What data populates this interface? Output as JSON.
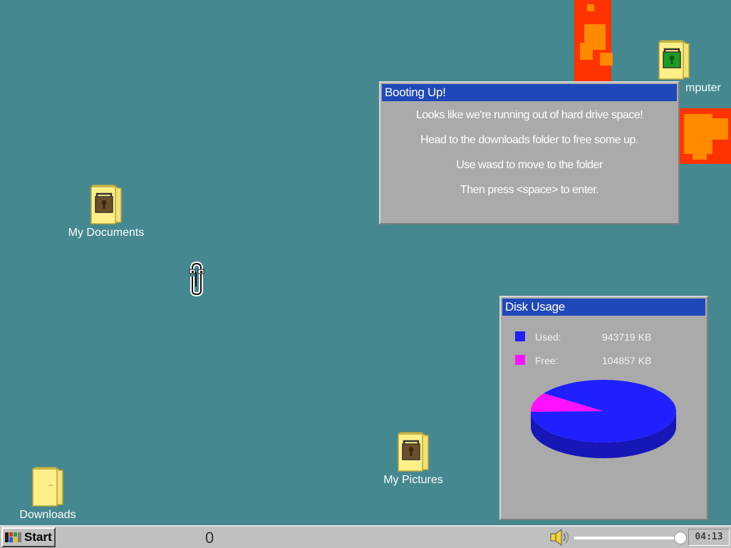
{
  "desktop": {
    "background": "#458890",
    "icons": [
      {
        "label": "My Documents",
        "icon": "locked-folder-icon",
        "lock_color": "#6b4f2a"
      },
      {
        "label": "mputer",
        "icon": "locked-folder-icon",
        "lock_color": "#1d9a22"
      },
      {
        "label": "My Pictures",
        "icon": "locked-folder-icon",
        "lock_color": "#6b4f2a"
      },
      {
        "label": "Downloads",
        "icon": "folder-icon"
      }
    ],
    "player": {
      "icon": "paperclip-icon"
    },
    "hazard": {
      "icon": "fire-block-icon",
      "colors": [
        "#ff3300",
        "#ff8a00"
      ]
    }
  },
  "boot_dialog": {
    "title": "Booting Up!",
    "lines": [
      "Looks like we're running out of hard drive space!",
      "Head to the downloads folder to free some up.",
      "Use wasd to move to the folder",
      "Then press <space> to enter."
    ]
  },
  "disk_usage": {
    "title": "Disk Usage",
    "legend": [
      {
        "name": "Used:",
        "value": "943719 KB",
        "color": "#2020ff"
      },
      {
        "name": "Free:",
        "value": "104857 KB",
        "color": "#ff10ff"
      }
    ]
  },
  "chart_data": {
    "type": "pie",
    "style": "3d",
    "categories": [
      "Used:",
      "Free:"
    ],
    "values": [
      943719,
      104857
    ],
    "units": "KB",
    "colors": [
      "#2020ff",
      "#ff10ff"
    ]
  },
  "taskbar": {
    "start_label": "Start",
    "score": "0",
    "volume_level": 0.99,
    "volume_icon": "speaker-icon",
    "clock": "04:13"
  }
}
